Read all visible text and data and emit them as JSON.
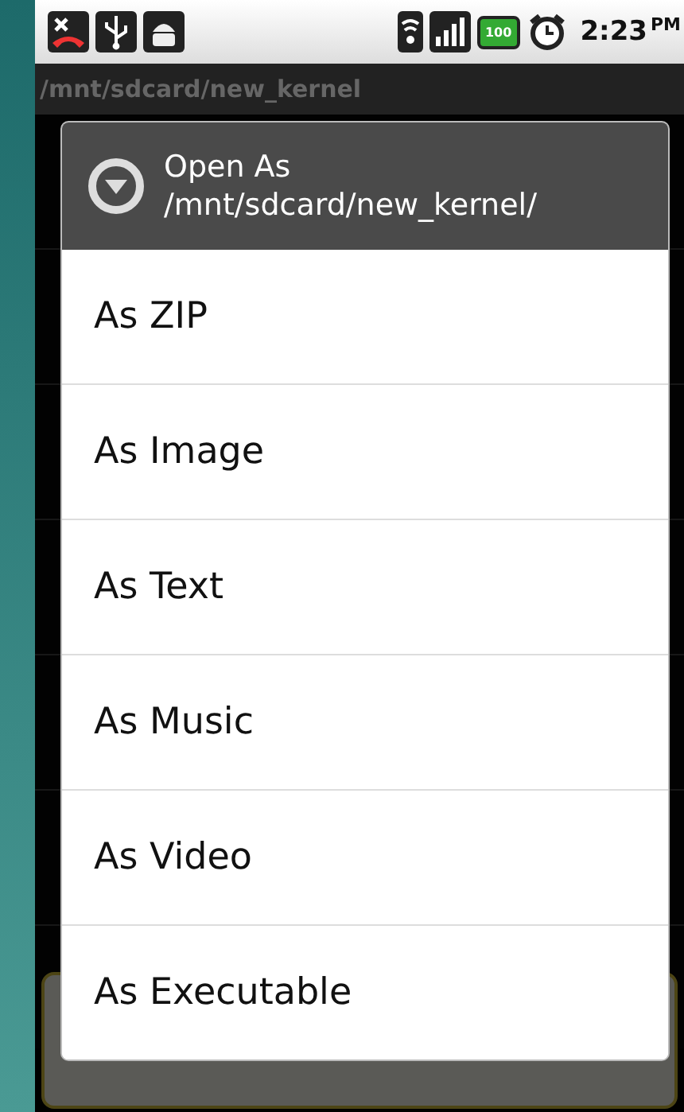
{
  "status_bar": {
    "battery": "100",
    "time": "2:23",
    "am_pm": "PM"
  },
  "path_bar": {
    "path": "/mnt/sdcard/new_kernel"
  },
  "dialog": {
    "title": "Open As",
    "subtitle": "/mnt/sdcard/new_kernel/",
    "items": [
      {
        "label": "As ZIP"
      },
      {
        "label": "As Image"
      },
      {
        "label": "As Text"
      },
      {
        "label": "As Music"
      },
      {
        "label": "As Video"
      },
      {
        "label": "As Executable"
      }
    ]
  }
}
